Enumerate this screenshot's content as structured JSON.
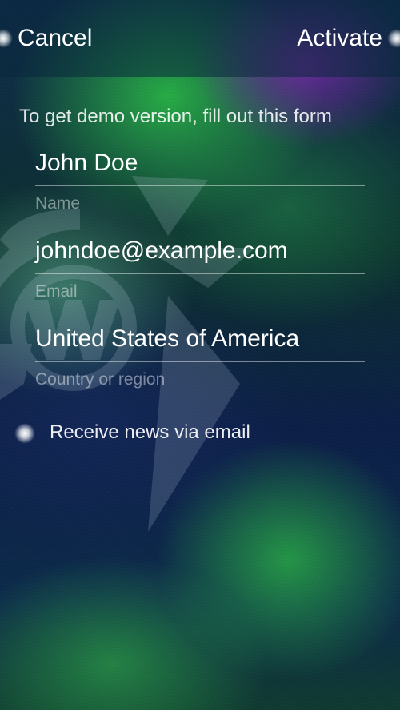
{
  "header": {
    "cancel_label": "Cancel",
    "activate_label": "Activate"
  },
  "form": {
    "title": "To get demo version, fill out this form",
    "fields": [
      {
        "value": "John Doe",
        "label": "Name"
      },
      {
        "value": "johndoe@example.com",
        "label": "Email"
      },
      {
        "value": "United States of America",
        "label": "Country or region"
      }
    ],
    "news_option": {
      "label": "Receive news via email",
      "checked": true
    }
  }
}
